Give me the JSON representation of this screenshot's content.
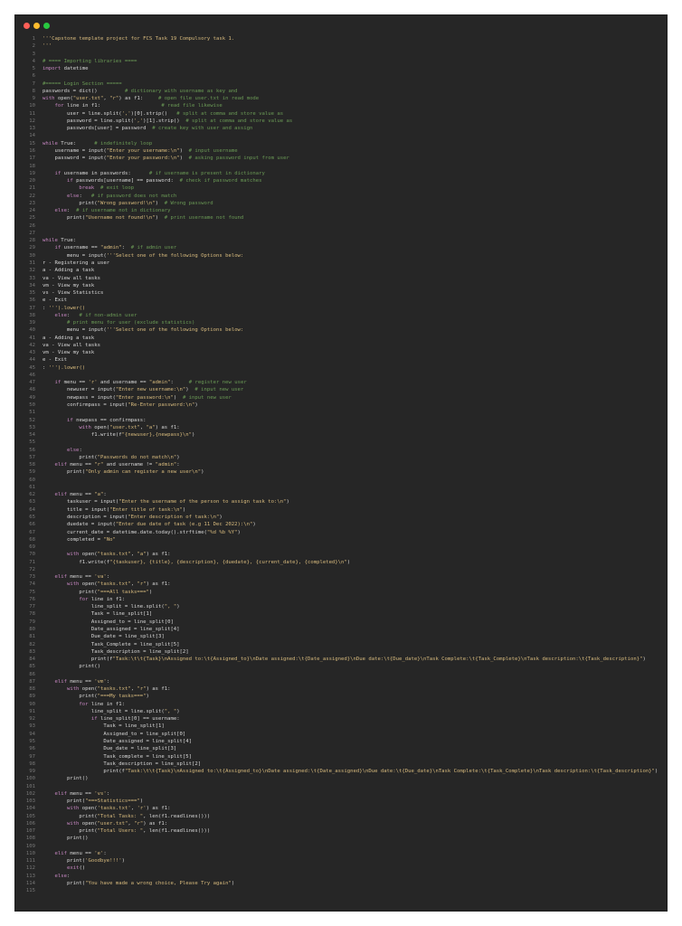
{
  "window": {
    "controls": [
      {
        "name": "close",
        "color": "#ff5f57"
      },
      {
        "name": "minimize",
        "color": "#febc2e"
      },
      {
        "name": "maximize",
        "color": "#28c840"
      }
    ]
  },
  "colors": {
    "background": "#262626",
    "text": "#d7d7d7",
    "line_number": "#777777",
    "keyword": "#c586c0",
    "string": "#d7ba7d",
    "comment": "#6a9955",
    "function": "#dcdcaa"
  },
  "code_lines": [
    "'''Capstone template project for FCS Task 19 Compulsory task 1.",
    "'''",
    "",
    "# ==== Importing libraries ====",
    "import datetime",
    "",
    "#===== Login Section =====",
    "passwords = dict()         # dictionary with username as key and",
    "with open(\"user.txt\", \"r\") as f1:     # open file user.txt in read mode",
    "    for line in f1:                    # read file likewise",
    "        user = line.split(',')[0].strip()   # split at comma and store value as",
    "        password = line.split(',')[1].strip()  # split at comma and store value as",
    "        passwords[user] = password  # create key with user and assign",
    "",
    "while True:      # indefinitely loop",
    "    username = input(\"Enter your username:\\n\")  # input username",
    "    password = input(\"Enter your password:\\n\")  # asking password input from user",
    "",
    "    if username in passwords:      # if username is present in dictionary",
    "        if passwords[username] == password:  # check if password matches",
    "            break  # exit loop",
    "        else:   # if password does not match",
    "            print(\"Wrong password!\\n\")  # Wrong password",
    "    else:  # if username not in dictionary",
    "        print(\"Username not found!\\n\")  # print username not found",
    "",
    "",
    "while True:",
    "    if username == \"admin\":  # if admin user",
    "        menu = input('''Select one of the following Options below:",
    "r - Registering a user",
    "a - Adding a task",
    "va - View all tasks",
    "vm - View my task",
    "vs - View Statistics",
    "e - Exit",
    ": ''').lower()",
    "    else:   # if non-admin user",
    "        # print menu for user (exclude statistics)",
    "        menu = input('''Select one of the following Options below:",
    "a - Adding a task",
    "va - View all tasks",
    "vm - View my task",
    "e - Exit",
    ": ''').lower()",
    "",
    "    if menu == 'r' and username == \"admin\":     # register new user",
    "        newuser = input(\"Enter new username:\\n\")  # input new user",
    "        newpass = input(\"Enter password:\\n\")  # input new user",
    "        confirmpass = input(\"Re-Enter password:\\n\")",
    "",
    "        if newpass == confirmpass:",
    "            with open(\"user.txt\", \"a\") as f1:",
    "                f1.write(f\"{newuser},{newpass}\\n\")",
    "",
    "        else:",
    "            print(\"Passwords do not match\\n\")",
    "    elif menu == \"r\" and username != \"admin\":",
    "        print(\"Only admin can register a new user\\n\")",
    "",
    "",
    "    elif menu == \"a\":",
    "        taskuser = input(\"Enter the username of the person to assign task to:\\n\")",
    "        title = input(\"Enter title of task:\\n\")",
    "        description = input(\"Enter description of task:\\n\")",
    "        duedate = input(\"Enter due date of task (e.g 11 Dec 2022):\\n\")",
    "        current_date = datetime.date.today().strftime(\"%d %b %Y\")",
    "        completed = \"No\"",
    "",
    "        with open(\"tasks.txt\", \"a\") as f1:",
    "            f1.write(f\"{taskuser}, {title}, {description}, {duedate}, {current_date}, {completed}\\n\")",
    "",
    "    elif menu == 'va':",
    "        with open(\"tasks.txt\", \"r\") as f1:",
    "            print(\"===All tasks===\")",
    "            for line in f1:",
    "                line_split = line.split(\", \")",
    "                Task = line_split[1]",
    "                Assigned_to = line_split[0]",
    "                Date_assigned = line_split[4]",
    "                Due_date = line_split[3]",
    "                Task_Complete = line_split[5]",
    "                Task_description = line_split[2]",
    "                print(f\"Task:\\t\\t{Task}\\nAssigned to:\\t{Assigned_to}\\nDate assigned:\\t{Date_assigned}\\nDue date:\\t{Due_date}\\nTask Complete:\\t{Task_Complete}\\nTask description:\\t{Task_description}\")",
    "            print()",
    "",
    "    elif menu == 'vm':",
    "        with open(\"tasks.txt\", \"r\") as f1:",
    "            print(\"===My tasks===\")",
    "            for line in f1:",
    "                line_split = line.split(\", \")",
    "                if line_split[0] == username:",
    "                    Task = line_split[1]",
    "                    Assigned_to = line_split[0]",
    "                    Date_assigned = line_split[4]",
    "                    Due_date = line_split[3]",
    "                    Task_complete = line_split[5]",
    "                    Task_description = line_split[2]",
    "                    print(f\"Task:\\t\\t{Task}\\nAssigned to:\\t{Assigned_to}\\nDate assigned:\\t{Date_assigned}\\nDue date:\\t{Due_date}\\nTask Complete:\\t{Task_Complete}\\nTask description:\\t{Task_description}\")",
    "        print()",
    "",
    "    elif menu == 'vs':",
    "        print(\"===Statistics===\")",
    "        with open('tasks.txt', 'r') as f1:",
    "            print(\"Total Tasks: \", len(f1.readlines()))",
    "        with open(\"user.txt\", \"r\") as f1:",
    "            print(\"Total Users: \", len(f1.readlines()))",
    "        print()",
    "",
    "    elif menu == 'e':",
    "        print('Goodbye!!!')",
    "        exit()",
    "    else:",
    "        print(\"You have made a wrong choice, Please Try again\")",
    ""
  ]
}
